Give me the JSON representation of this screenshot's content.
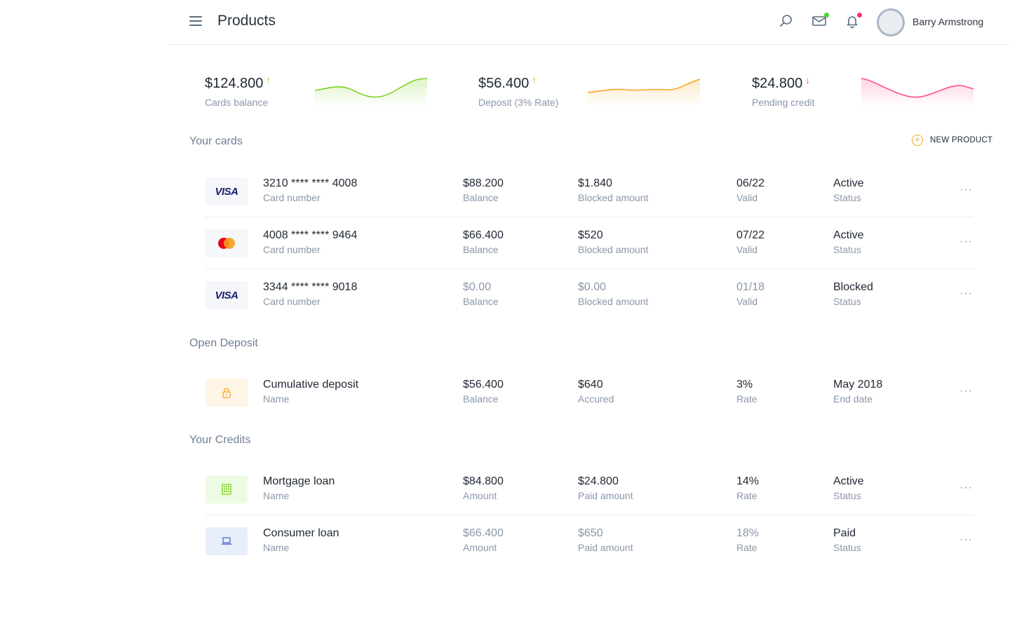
{
  "header": {
    "title": "Products",
    "user_name": "Barry Armstrong",
    "icons": [
      "menu-icon",
      "search-icon",
      "mail-icon",
      "bell-icon",
      "avatar"
    ],
    "mail_dot_color": "#4cd137",
    "bell_dot_color": "#ff2d78"
  },
  "stats": [
    {
      "value": "$124.800",
      "label": "Cards balance",
      "trend": "up",
      "color": "#7ed321"
    },
    {
      "value": "$56.400",
      "label": "Deposit (3% Rate)",
      "trend": "up",
      "color": "#f5a623"
    },
    {
      "value": "$24.800",
      "label": "Pending credit",
      "trend": "down",
      "color": "#ff4f8b"
    }
  ],
  "sections": {
    "cards_title": "Your cards",
    "new_product": "NEW PRODUCT",
    "deposit_title": "Open Deposit",
    "credits_title": "Your Credits"
  },
  "cards": [
    {
      "brand": "VISA",
      "number": "3210 **** **** 4008",
      "number_label": "Card number",
      "balance": "$88.200",
      "balance_label": "Balance",
      "blocked": "$1.840",
      "blocked_label": "Blocked amount",
      "valid": "06/22",
      "valid_label": "Valid",
      "status": "Active",
      "status_label": "Status"
    },
    {
      "brand": "mastercard",
      "number": "4008 **** **** 9464",
      "number_label": "Card number",
      "balance": "$66.400",
      "balance_label": "Balance",
      "blocked": "$520",
      "blocked_label": "Blocked amount",
      "valid": "07/22",
      "valid_label": "Valid",
      "status": "Active",
      "status_label": "Status"
    },
    {
      "brand": "VISA",
      "number": "3344 **** **** 9018",
      "number_label": "Card number",
      "balance": "$0.00",
      "balance_label": "Balance",
      "blocked": "$0.00",
      "blocked_label": "Blocked amount",
      "valid": "01/18",
      "valid_label": "Valid",
      "status": "Blocked",
      "status_label": "Status"
    }
  ],
  "deposit": {
    "name": "Cumulative deposit",
    "name_label": "Name",
    "balance": "$56.400",
    "balance_label": "Balance",
    "accured": "$640",
    "accured_label": "Accured",
    "rate": "3%",
    "rate_label": "Rate",
    "end_date": "May 2018",
    "end_date_label": "End date",
    "icon": "lock-icon",
    "color": "#f5a623"
  },
  "credits": [
    {
      "name": "Mortgage loan",
      "name_label": "Name",
      "amount": "$84.800",
      "amount_label": "Amount",
      "paid": "$24.800",
      "paid_label": "Paid amount",
      "rate": "14%",
      "rate_label": "Rate",
      "status": "Active",
      "status_label": "Status",
      "icon": "building-icon",
      "color": "#7ed321"
    },
    {
      "name": "Consumer loan",
      "name_label": "Name",
      "amount": "$66.400",
      "amount_label": "Amount",
      "paid": "$650",
      "paid_label": "Paid amount",
      "rate": "18%",
      "rate_label": "Rate",
      "status": "Paid",
      "status_label": "Status",
      "icon": "laptop-icon",
      "color": "#4a6fd1"
    }
  ]
}
